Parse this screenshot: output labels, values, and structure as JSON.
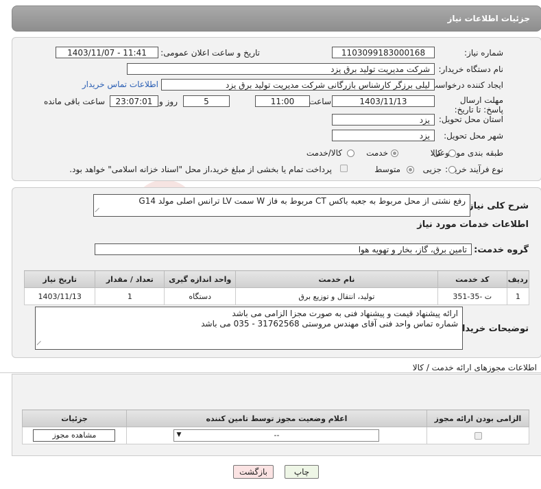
{
  "header": {
    "title": "جزئیات اطلاعات نیاز"
  },
  "form": {
    "need_number_label": "شماره نیاز:",
    "need_number": "1103099183000168",
    "announce_label": "تاریخ و ساعت اعلان عمومی:",
    "announce_value": "1403/11/07 - 11:41",
    "buyer_label": "نام دستگاه خریدار:",
    "buyer_value": "شرکت مدیریت تولید برق یزد",
    "creator_label": "ایجاد کننده درخواست:",
    "creator_value": "لیلی برزگر کارشناس بازرگانی شرکت مدیریت تولید برق یزد",
    "contact_link": "اطلاعات تماس خریدار",
    "deadline_label": "مهلت ارسال پاسخ: تا تاریخ:",
    "deadline_date": "1403/11/13",
    "time_label": "ساعت",
    "deadline_time": "11:00",
    "days_value": "5",
    "days_label": "روز و",
    "remaining_time": "23:07:01",
    "remaining_label": "ساعت باقی مانده",
    "province_label": "استان محل تحویل:",
    "province_value": "یزد",
    "city_label": "شهر محل تحویل:",
    "city_value": "یزد",
    "category_label": "طبقه بندی موضوعی:",
    "category_options": [
      "کالا",
      "خدمت",
      "کالا/خدمت"
    ],
    "category_selected": "خدمت",
    "process_label": "نوع فرآیند خرید :",
    "process_options": [
      "جزیی",
      "متوسط"
    ],
    "process_selected": "متوسط",
    "treasury_text": "پرداخت تمام یا بخشی از مبلغ خرید،از محل \"اسناد خزانه اسلامی\" خواهد بود."
  },
  "description": {
    "label": "شرح کلی نیاز:",
    "value": "رفع نشتی از محل مربوط به جعبه باکس CT  مربوط به فاز W  سمت LV  ترانس اصلی مولد G14",
    "services_title": "اطلاعات خدمات مورد نیاز",
    "group_label": "گروه خدمت:",
    "group_value": "تامین برق، گاز، بخار و تهویه هوا"
  },
  "service_table": {
    "headers": [
      "ردیف",
      "کد خدمت",
      "نام خدمت",
      "واحد اندازه گیری",
      "تعداد / مقدار",
      "تاریخ نیاز"
    ],
    "rows": [
      {
        "row": "1",
        "code": "ت -35-351",
        "name": "تولید، انتقال و توزیع برق",
        "unit": "دستگاه",
        "qty": "1",
        "date": "1403/11/13"
      }
    ]
  },
  "buyer_notes": {
    "label": "توضیحات خریدار:",
    "line1": "ارائه پیشنهاد قیمت و پیشنهاد فنی به صورت مجزا الزامی می باشد",
    "line2": "شماره تماس واحد فنی آقای مهندس مروستی 31762568 - 035 می باشد"
  },
  "permits": {
    "title": "اطلاعات مجوزهای ارائه خدمت / کالا",
    "headers": [
      "الزامی بودن ارائه مجوز",
      "اعلام وضعیت مجوز توسط تامین کننده",
      "جزئیات"
    ],
    "select_value": "--",
    "view_button": "مشاهده مجوز"
  },
  "footer": {
    "print_button": "چاپ",
    "back_button": "بازگشت"
  },
  "watermark": {
    "text": "AriaTender.neT"
  }
}
